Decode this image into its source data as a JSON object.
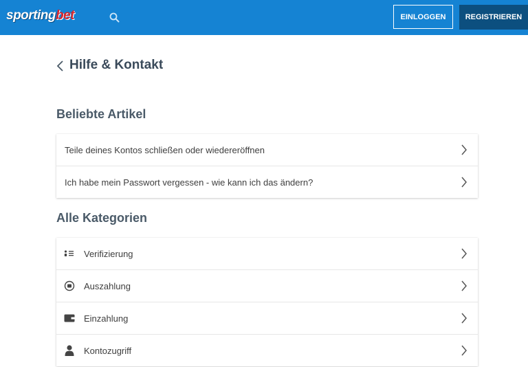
{
  "header": {
    "logo_main": "sporting",
    "logo_accent": "bet",
    "login_label": "EINLOGGEN",
    "register_label": "REGISTRIEREN"
  },
  "page": {
    "title": "Hilfe & Kontakt"
  },
  "popular": {
    "heading": "Beliebte Artikel",
    "items": [
      {
        "label": "Teile deines Kontos schließen oder wiedereröffnen"
      },
      {
        "label": "Ich habe mein Passwort vergessen - wie kann ich das ändern?"
      }
    ]
  },
  "categories": {
    "heading": "Alle Kategorien",
    "items": [
      {
        "label": "Verifizierung",
        "icon": "verification-icon"
      },
      {
        "label": "Auszahlung",
        "icon": "withdrawal-icon"
      },
      {
        "label": "Einzahlung",
        "icon": "wallet-icon"
      },
      {
        "label": "Kontozugriff",
        "icon": "user-icon"
      }
    ]
  },
  "colors": {
    "header_bg": "#1583d3",
    "register_bg": "#0c4f7f",
    "heading_text": "#4a5a68"
  }
}
